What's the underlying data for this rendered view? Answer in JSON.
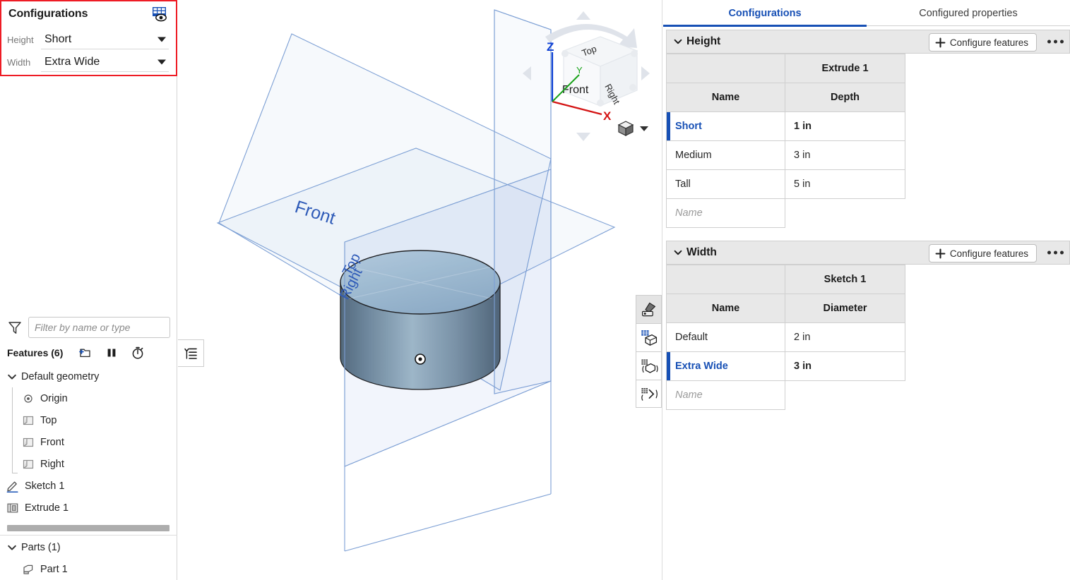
{
  "left_panel": {
    "configurations_box": {
      "title": "Configurations",
      "grid_icon": "configuration-table-eye-icon",
      "inputs": [
        {
          "label": "Height",
          "value": "Short",
          "icon": "chevron-down-icon"
        },
        {
          "label": "Width",
          "value": "Extra Wide",
          "icon": "chevron-down-icon"
        }
      ],
      "highlight_color": "#ee1c25"
    },
    "filter": {
      "icon": "filter-funnel-icon",
      "placeholder": "Filter by name or type",
      "value": ""
    },
    "features_header": {
      "title": "Features (6)",
      "tools": [
        {
          "icon": "add-folder-icon"
        },
        {
          "icon": "rollback-pause-icon"
        },
        {
          "icon": "stopwatch-icon"
        }
      ]
    },
    "tree_tab_icon": "collapse-tree-icon",
    "tree": [
      {
        "label": "Default geometry",
        "icon": "chevron-down-icon",
        "level": 0,
        "expandable": true
      },
      {
        "label": "Origin",
        "icon": "origin-point-icon",
        "level": 1,
        "expandable": false
      },
      {
        "label": "Top",
        "icon": "plane-icon",
        "level": 1,
        "expandable": false
      },
      {
        "label": "Front",
        "icon": "plane-icon",
        "level": 1,
        "expandable": false
      },
      {
        "label": "Right",
        "icon": "plane-icon",
        "level": 1,
        "expandable": false
      },
      {
        "label": "Sketch 1",
        "icon": "sketch-pencil-icon",
        "level": 0,
        "expandable": false
      },
      {
        "label": "Extrude 1",
        "icon": "extrude-icon",
        "level": 0,
        "expandable": false
      }
    ],
    "parts_section": {
      "label": "Parts (1)",
      "icon": "chevron-down-icon",
      "items": [
        {
          "label": "Part 1",
          "icon": "part-solid-icon"
        }
      ]
    }
  },
  "viewport": {
    "plane_labels": [
      {
        "name": "Front"
      },
      {
        "name": "Top"
      },
      {
        "name": "Right"
      }
    ],
    "view_cube": {
      "faces": [
        "Top",
        "Front",
        "Right"
      ],
      "axes": [
        {
          "name": "Z",
          "color": "#0d3fd4"
        },
        {
          "name": "Y",
          "color": "#19a319"
        },
        {
          "name": "X",
          "color": "#d41414"
        }
      ]
    },
    "display_mode": {
      "icon": "shaded-cube-icon",
      "caret": "chevron-down-icon"
    },
    "toolbar": [
      {
        "icon": "appearance-brush-icon",
        "active": true
      },
      {
        "icon": "section-view-icon",
        "active": false
      },
      {
        "icon": "explode-view-icon",
        "active": false
      },
      {
        "icon": "measure-icon",
        "active": false
      }
    ],
    "origin_marker": "part-origin-icon",
    "model": {
      "shape": "cylinder",
      "color": "#a6bdd0"
    }
  },
  "right_panel": {
    "tabs": [
      {
        "label": "Configurations",
        "active": true
      },
      {
        "label": "Configured properties",
        "active": false
      }
    ],
    "accent_color": "#1750b5",
    "groups": [
      {
        "name": "Height",
        "chevron": "chevron-down-icon",
        "configure_button": {
          "label": "Configure features",
          "icon": "plus-icon"
        },
        "more_icon": "more-options-icon",
        "feature_header": "Extrude 1",
        "columns": [
          "Name",
          "Depth"
        ],
        "rows": [
          {
            "name": "Short",
            "value": "1 in",
            "selected": true
          },
          {
            "name": "Medium",
            "value": "3 in",
            "selected": false
          },
          {
            "name": "Tall",
            "value": "5 in",
            "selected": false
          }
        ],
        "new_row_placeholder": "Name"
      },
      {
        "name": "Width",
        "chevron": "chevron-down-icon",
        "configure_button": {
          "label": "Configure features",
          "icon": "plus-icon"
        },
        "more_icon": "more-options-icon",
        "feature_header": "Sketch 1",
        "columns": [
          "Name",
          "Diameter"
        ],
        "rows": [
          {
            "name": "Default",
            "value": "2 in",
            "selected": false
          },
          {
            "name": "Extra Wide",
            "value": "3 in",
            "selected": true
          }
        ],
        "new_row_placeholder": "Name"
      }
    ]
  }
}
